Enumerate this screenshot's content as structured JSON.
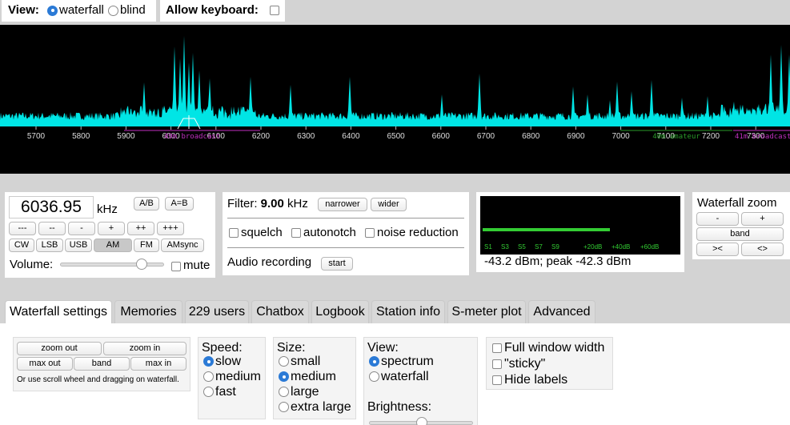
{
  "top_bar": {
    "view_label": "View:",
    "view_options": [
      {
        "label": "waterfall",
        "selected": true
      },
      {
        "label": "blind",
        "selected": false
      }
    ],
    "allow_keyboard_label": "Allow keyboard:"
  },
  "spectrum": {
    "trace_color": "#00e5e5",
    "freq_ticks": [
      "5700",
      "5800",
      "5900",
      "6000",
      "6100",
      "6200",
      "6300",
      "6400",
      "6500",
      "6600",
      "6700",
      "6800",
      "6900",
      "7000",
      "7100",
      "7200",
      "7300"
    ],
    "bands": [
      {
        "label": "49m broadcast",
        "color": "#c030c0"
      },
      {
        "label": "40m amateur",
        "color": "#2a9a2a"
      },
      {
        "label": "41m broadcast",
        "color": "#c030c0"
      }
    ]
  },
  "tuning": {
    "frequency": "6036.95",
    "unit": "kHz",
    "ab_label": "A/B",
    "aeqb_label": "A=B",
    "step_buttons": [
      "---",
      "--",
      "-",
      "+",
      "++",
      "+++"
    ],
    "modes": [
      {
        "label": "CW",
        "selected": false
      },
      {
        "label": "LSB",
        "selected": false
      },
      {
        "label": "USB",
        "selected": false
      },
      {
        "label": "AM",
        "selected": true
      },
      {
        "label": "FM",
        "selected": false
      },
      {
        "label": "AMsync",
        "selected": false
      }
    ],
    "volume_label": "Volume:",
    "volume_level": 0.78,
    "mute_label": "mute"
  },
  "filter": {
    "label": "Filter:",
    "value": "9.00",
    "unit": "kHz",
    "narrower_label": "narrower",
    "wider_label": "wider",
    "checks": [
      "squelch",
      "autonotch",
      "noise reduction"
    ],
    "audio_recording_label": "Audio recording",
    "start_label": "start"
  },
  "smeter": {
    "bar_color": "#33cc33",
    "level_fraction": 0.6,
    "scale": [
      "S1",
      "S3",
      "S5",
      "S7",
      "S9",
      "+20dB",
      "+40dB",
      "+60dB"
    ],
    "readout": "-43.2 dBm; peak  -42.3 dBm"
  },
  "waterfall_zoom": {
    "title": "Waterfall zoom",
    "buttons": [
      "-",
      "+",
      "band",
      "><",
      "<>"
    ]
  },
  "tabs": [
    {
      "label": "Waterfall settings",
      "active": true
    },
    {
      "label": "Memories",
      "active": false
    },
    {
      "label": "229 users",
      "active": false
    },
    {
      "label": "Chatbox",
      "active": false
    },
    {
      "label": "Logbook",
      "active": false
    },
    {
      "label": "Station info",
      "active": false
    },
    {
      "label": "S-meter plot",
      "active": false
    },
    {
      "label": "Advanced",
      "active": false
    }
  ],
  "waterfall_settings": {
    "zoom_buttons": [
      "zoom out",
      "zoom in",
      "max out",
      "band",
      "max in"
    ],
    "hint": "Or use scroll wheel and dragging on waterfall.",
    "speed": {
      "label": "Speed:",
      "options": [
        {
          "label": "slow",
          "selected": true
        },
        {
          "label": "medium",
          "selected": false
        },
        {
          "label": "fast",
          "selected": false
        }
      ]
    },
    "size": {
      "label": "Size:",
      "options": [
        {
          "label": "small",
          "selected": false
        },
        {
          "label": "medium",
          "selected": true
        },
        {
          "label": "large",
          "selected": false
        },
        {
          "label": "extra large",
          "selected": false
        }
      ]
    },
    "view": {
      "label": "View:",
      "options": [
        {
          "label": "spectrum",
          "selected": true
        },
        {
          "label": "waterfall",
          "selected": false
        }
      ]
    },
    "brightness_label": "Brightness:",
    "brightness_level": 0.5,
    "checks": [
      "Full window width",
      "\"sticky\"",
      "Hide labels"
    ]
  }
}
